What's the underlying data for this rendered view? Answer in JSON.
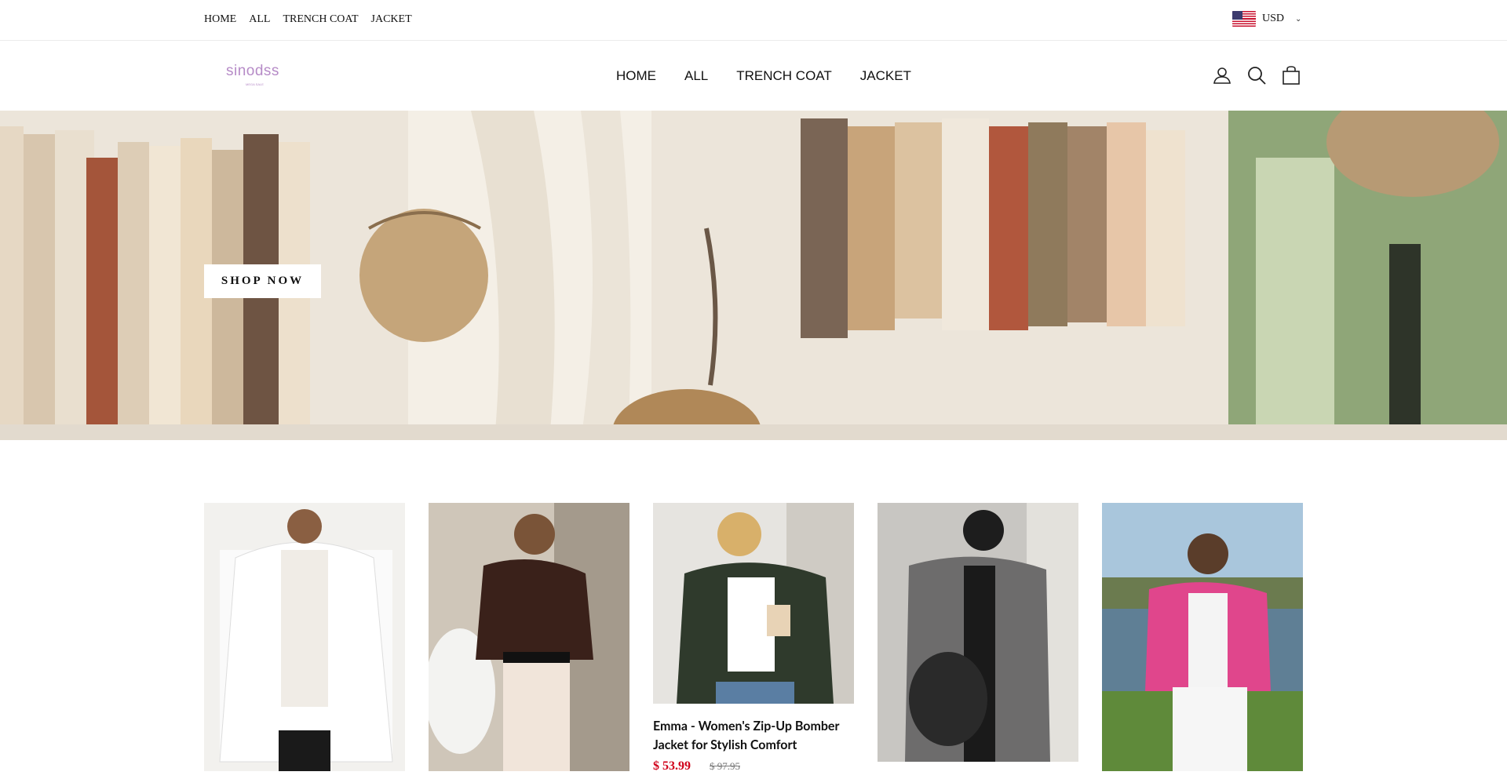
{
  "topbar": {
    "nav": [
      "HOME",
      "ALL",
      "TRENCH COAT",
      "JACKET"
    ],
    "currency": "USD"
  },
  "header": {
    "logo": "sinodss",
    "logo_sub": "MEGA SALE",
    "nav": [
      "HOME",
      "ALL",
      "TRENCH COAT",
      "JACKET"
    ],
    "icons": [
      "account-icon",
      "search-icon",
      "cart-icon"
    ]
  },
  "hero": {
    "button": "SHOP NOW"
  },
  "products": [
    {
      "image": "white cable-knit zip cardigan"
    },
    {
      "image": "brown leather bomber jacket"
    },
    {
      "image": "olive zip-up bomber jacket",
      "title": "Emma - Women's Zip-Up Bomber Jacket for Stylish Comfort",
      "price": "$ 53.99",
      "compare_price": "$ 97.95"
    },
    {
      "image": "grey wool coat"
    },
    {
      "image": "pink cropped shirt jacket"
    }
  ],
  "colors": {
    "sale_price": "#d0021b",
    "logo": "#b68bc7"
  }
}
